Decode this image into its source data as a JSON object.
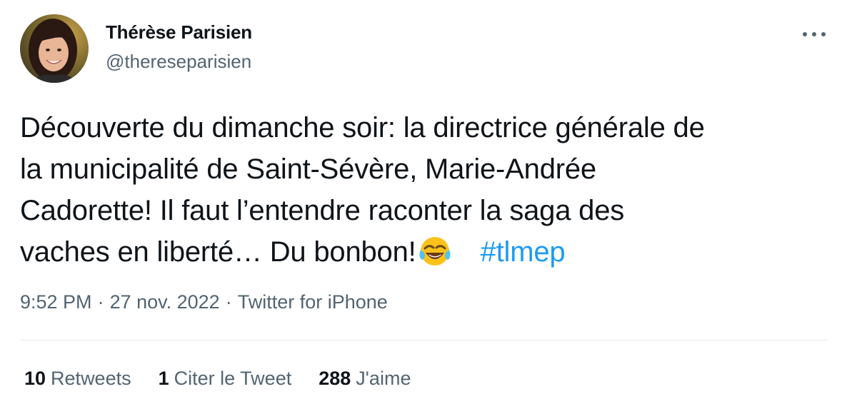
{
  "author": {
    "display_name": "Thérèse Parisien",
    "handle": "@thereseparisien"
  },
  "tweet": {
    "lines": [
      "Découverte du dimanche soir: la directrice générale de",
      "la municipalité de Saint-Sévère, Marie-Andrée",
      "Cadorette! Il faut l’entendre raconter la saga des",
      "vaches en liberté… Du bonbon!"
    ],
    "emoji": "face-with-tears-of-joy",
    "hashtag": "#tlmep"
  },
  "meta": {
    "time": "9:52 PM",
    "separator": "·",
    "date": "27 nov. 2022",
    "source": "Twitter for iPhone"
  },
  "stats": {
    "retweets_count": "10",
    "retweets_label": "Retweets",
    "quotes_count": "1",
    "quotes_label": "Citer le Tweet",
    "likes_count": "288",
    "likes_label": "J'aime"
  },
  "colors": {
    "text": "#0f1419",
    "secondary": "#536471",
    "link": "#1d9bf0",
    "divider": "#e6e9eb"
  }
}
